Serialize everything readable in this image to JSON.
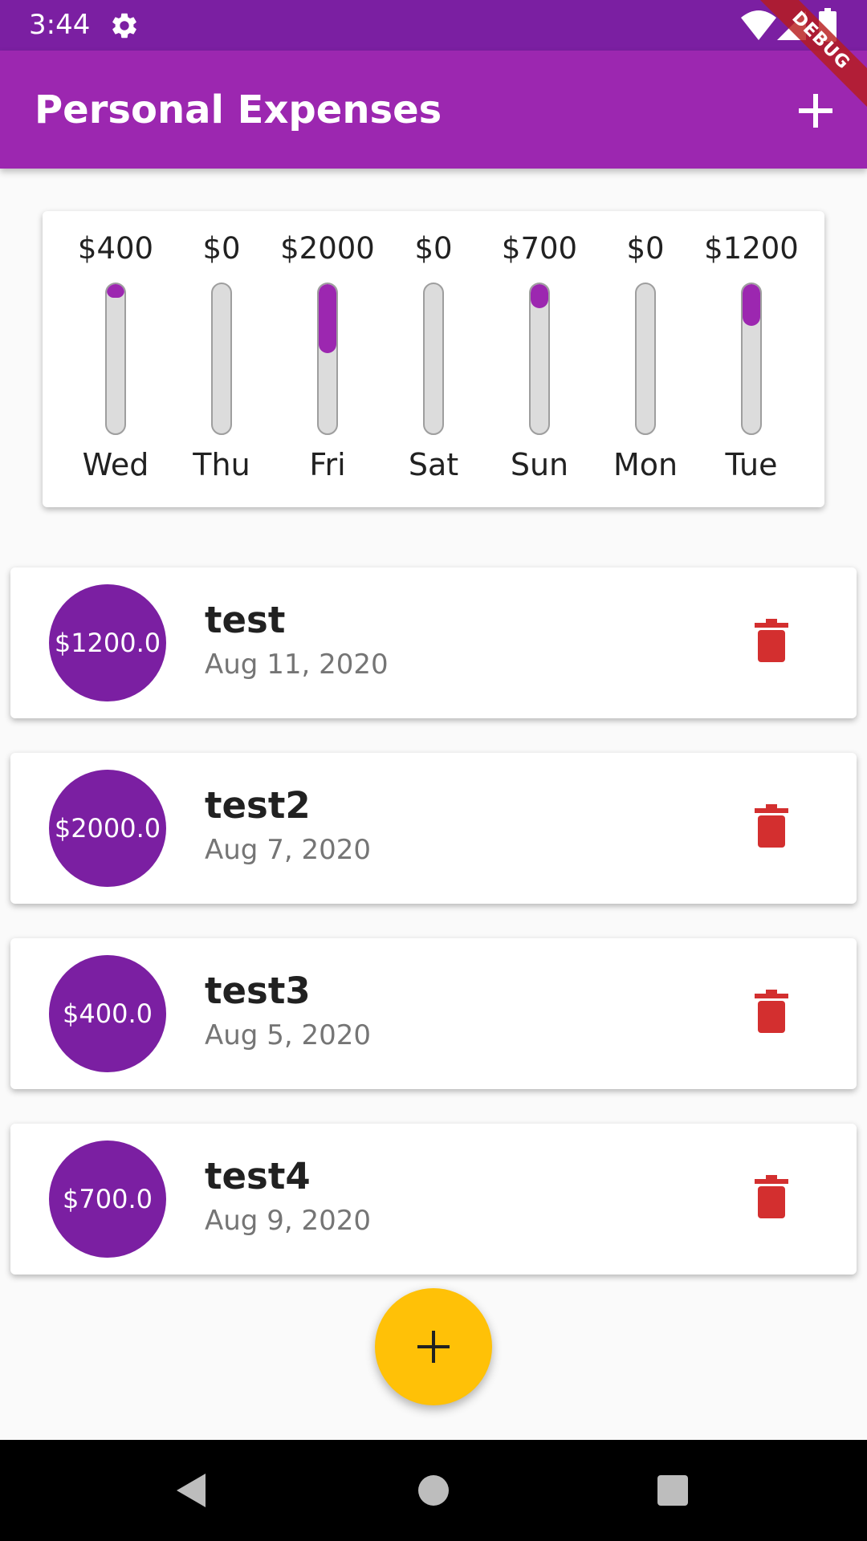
{
  "status_bar": {
    "time": "3:44"
  },
  "app_bar": {
    "title": "Personal Expenses"
  },
  "debug_banner": {
    "label": "DEBUG"
  },
  "chart_data": {
    "type": "bar",
    "categories": [
      "Wed",
      "Thu",
      "Fri",
      "Sat",
      "Sun",
      "Mon",
      "Tue"
    ],
    "value_labels": [
      "$400",
      "$0",
      "$2000",
      "$0",
      "$700",
      "$0",
      "$1200"
    ],
    "values": [
      400,
      0,
      2000,
      0,
      700,
      0,
      1200
    ],
    "fill_percent": [
      9.3,
      0,
      46.5,
      0,
      16.3,
      0,
      27.9
    ]
  },
  "transactions": [
    {
      "amount": "$1200.0",
      "title": "test",
      "date": "Aug 11, 2020"
    },
    {
      "amount": "$2000.0",
      "title": "test2",
      "date": "Aug 7, 2020"
    },
    {
      "amount": "$400.0",
      "title": "test3",
      "date": "Aug 5, 2020"
    },
    {
      "amount": "$700.0",
      "title": "test4",
      "date": "Aug 9, 2020"
    }
  ],
  "icons": {
    "status_gear": "gear-icon",
    "status_wifi": "wifi-icon",
    "status_signal": "signal-icon",
    "status_battery": "battery-icon",
    "app_add": "plus-icon",
    "delete": "trash-icon",
    "fab": "plus-icon",
    "nav_back": "back-triangle-icon",
    "nav_home": "home-circle-icon",
    "nav_recents": "recents-square-icon"
  },
  "colors": {
    "status_bar": "#7b1fa2",
    "app_bar": "#9c27b0",
    "accent": "#ffc107",
    "avatar": "#7b1fa2",
    "bar_fill": "#9c27b0",
    "bar_track": "#dcdcdc",
    "delete": "#d32f2f"
  }
}
